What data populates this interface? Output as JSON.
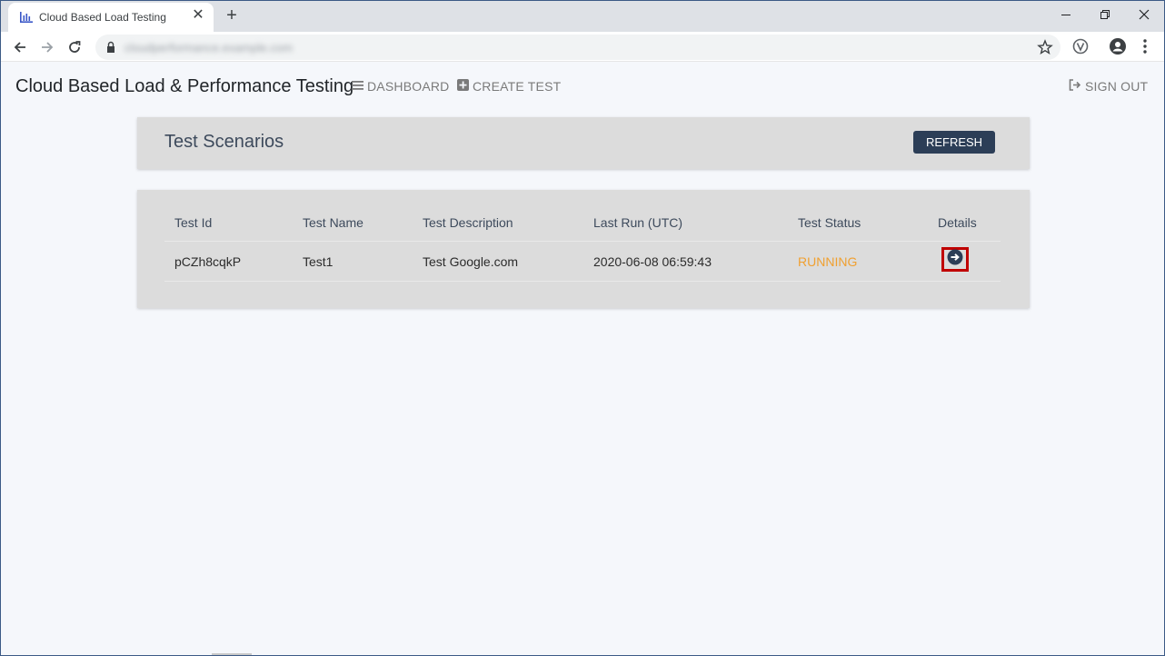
{
  "browser": {
    "tab_title": "Cloud Based Load Testing",
    "new_tab_glyph": "+",
    "close_glyph": "✕",
    "url": "cloudperformance.example.com",
    "window_controls": {
      "minimize": "—",
      "restore": "❐",
      "close": "✕"
    }
  },
  "header": {
    "app_title": "Cloud Based Load & Performance Testing",
    "nav": {
      "dashboard": "DASHBOARD",
      "create_test": "CREATE TEST",
      "sign_out": "SIGN OUT"
    }
  },
  "scenarios": {
    "title": "Test Scenarios",
    "refresh_label": "REFRESH"
  },
  "table": {
    "columns": {
      "id": "Test Id",
      "name": "Test Name",
      "description": "Test Description",
      "last_run": "Last Run (UTC)",
      "status": "Test Status",
      "details": "Details"
    },
    "rows": [
      {
        "id": "pCZh8cqkP",
        "name": "Test1",
        "description": "Test Google.com",
        "last_run": "2020-06-08 06:59:43",
        "status": "RUNNING"
      }
    ]
  },
  "colors": {
    "accent": "#2c3e57",
    "running": "#f0a030",
    "highlight_box": "#c00000"
  },
  "icons": [
    "chart-favicon-icon",
    "lock-icon",
    "star-icon",
    "extension-icon",
    "profile-icon",
    "menu-icon",
    "list-icon",
    "plus-square-icon",
    "sign-out-icon",
    "arrow-circle-right-icon"
  ]
}
